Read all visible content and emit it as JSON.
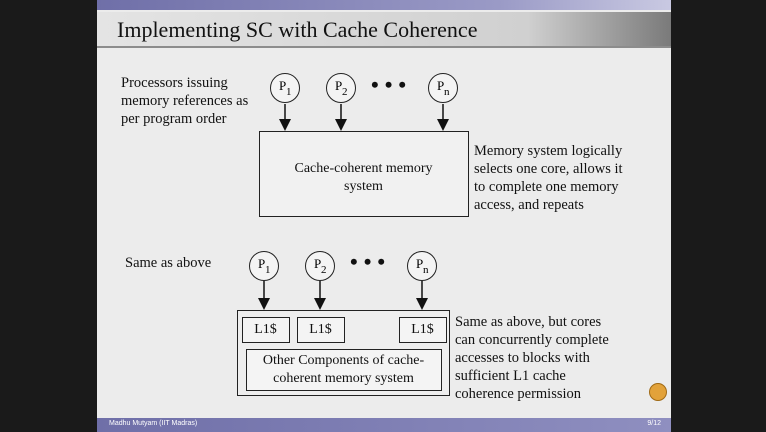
{
  "slide": {
    "title": "Implementing SC with Cache Coherence",
    "top": {
      "left_text": [
        "Processors issuing",
        "memory references as",
        "per program order"
      ],
      "processors": [
        {
          "label": "P",
          "sub": "1"
        },
        {
          "label": "P",
          "sub": "2"
        },
        {
          "label": "P",
          "sub": "n"
        }
      ],
      "ellipsis": "•••",
      "box_text": [
        "Cache-coherent memory",
        "system"
      ],
      "right_text": [
        "Memory system logically",
        "selects one core, allows it",
        "to complete one memory",
        "access, and repeats"
      ]
    },
    "bottom": {
      "left_text": "Same as above",
      "processors": [
        {
          "label": "P",
          "sub": "1"
        },
        {
          "label": "P",
          "sub": "2"
        },
        {
          "label": "P",
          "sub": "n"
        }
      ],
      "ellipsis": "•••",
      "caches": [
        "L1$",
        "L1$",
        "L1$"
      ],
      "other_box_text": [
        "Other Components of cache-",
        "coherent memory system"
      ],
      "right_text": [
        "Same as above, but cores",
        "can concurrently complete",
        "accesses to blocks with",
        "sufficient L1 cache",
        "coherence permission"
      ]
    },
    "footer": {
      "author": "Madhu Mutyam (IIT Madras)",
      "page": "9/12"
    }
  }
}
